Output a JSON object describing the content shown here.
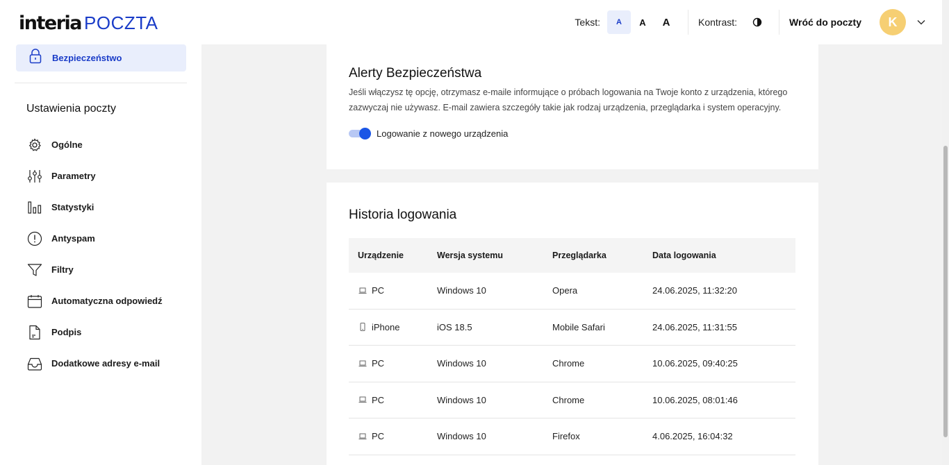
{
  "header": {
    "brand": "interia",
    "product": "POCZTA",
    "text_label": "Tekst:",
    "text_sizes": [
      "A",
      "A",
      "A"
    ],
    "contrast_label": "Kontrast:",
    "back_link": "Wróć do poczty",
    "avatar_initial": "K",
    "accent_color": "#1a3cc8"
  },
  "sidebar": {
    "active_item": {
      "label": "Bezpieczeństwo",
      "icon": "lock-icon"
    },
    "section_title": "Ustawienia poczty",
    "items": [
      {
        "label": "Ogólne",
        "icon": "gear-icon"
      },
      {
        "label": "Parametry",
        "icon": "sliders-icon"
      },
      {
        "label": "Statystyki",
        "icon": "bar-chart-icon"
      },
      {
        "label": "Antyspam",
        "icon": "alert-circle-icon"
      },
      {
        "label": "Filtry",
        "icon": "filter-icon"
      },
      {
        "label": "Automatyczna odpowiedź",
        "icon": "calendar-icon"
      },
      {
        "label": "Podpis",
        "icon": "document-icon"
      },
      {
        "label": "Dodatkowe adresy e-mail",
        "icon": "inbox-icon"
      }
    ]
  },
  "alerts": {
    "title": "Alerty Bezpieczeństwa",
    "description": "Jeśli włączysz tę opcję, otrzymasz e-maile informujące o próbach logowania na Twoje konto z urządzenia, którego zazwyczaj nie używasz. E-mail zawiera szczegóły takie jak rodzaj urządzenia, przeglądarka i system operacyjny.",
    "toggle_label": "Logowanie z nowego urządzenia",
    "toggle_on": true
  },
  "history": {
    "title": "Historia logowania",
    "columns": [
      "Urządzenie",
      "Wersja systemu",
      "Przeglądarka",
      "Data logowania"
    ],
    "rows": [
      {
        "device": "PC",
        "device_icon": "laptop-icon",
        "system": "Windows 10",
        "browser": "Opera",
        "date": "24.06.2025, 11:32:20"
      },
      {
        "device": "iPhone",
        "device_icon": "phone-icon",
        "system": "iOS 18.5",
        "browser": "Mobile Safari",
        "date": "24.06.2025, 11:31:55"
      },
      {
        "device": "PC",
        "device_icon": "laptop-icon",
        "system": "Windows 10",
        "browser": "Chrome",
        "date": "10.06.2025, 09:40:25"
      },
      {
        "device": "PC",
        "device_icon": "laptop-icon",
        "system": "Windows 10",
        "browser": "Chrome",
        "date": "10.06.2025, 08:01:46"
      },
      {
        "device": "PC",
        "device_icon": "laptop-icon",
        "system": "Windows 10",
        "browser": "Firefox",
        "date": "4.06.2025, 16:04:32"
      }
    ]
  }
}
